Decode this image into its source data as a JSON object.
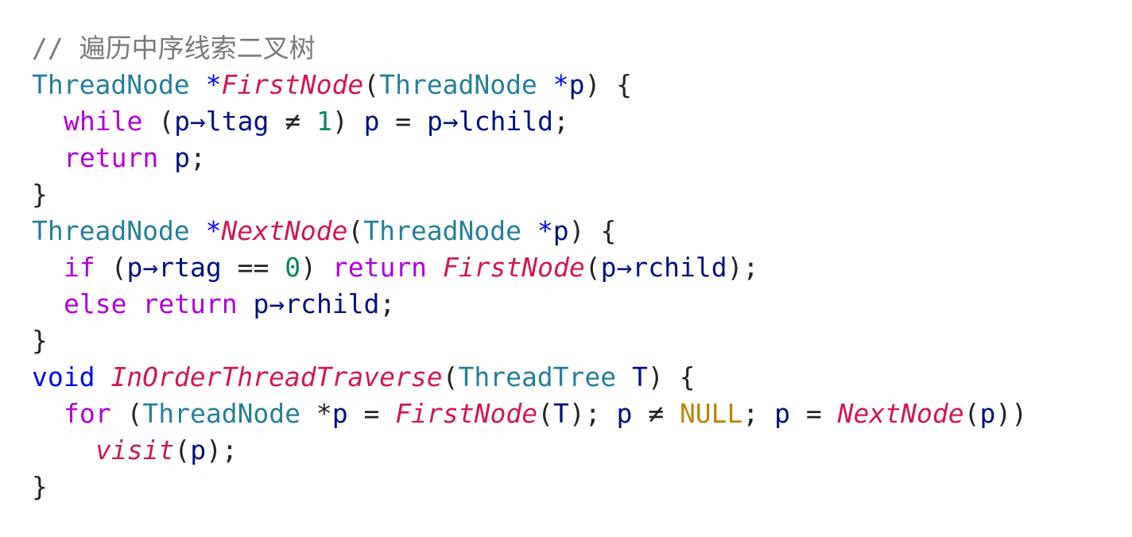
{
  "lines": [
    {
      "tokens": [
        "// 遍历中序线索二叉树"
      ]
    },
    {
      "tokens": [
        "ThreadNode",
        " ",
        "*",
        "FirstNode",
        "(",
        "ThreadNode",
        " ",
        "*",
        "p",
        ") {"
      ]
    },
    {
      "tokens": [
        "while",
        " (",
        "p",
        "→",
        "ltag",
        " ≠ ",
        "1",
        ") ",
        "p",
        " = ",
        "p",
        "→",
        "lchild",
        ";"
      ]
    },
    {
      "tokens": [
        "return",
        " ",
        "p",
        ";"
      ]
    },
    {
      "tokens": [
        "}"
      ]
    },
    {
      "tokens": [
        "ThreadNode",
        " ",
        "*",
        "NextNode",
        "(",
        "ThreadNode",
        " ",
        "*",
        "p",
        ") {"
      ]
    },
    {
      "tokens": [
        "if",
        " (",
        "p",
        "→",
        "rtag",
        " == ",
        "0",
        ") ",
        "return",
        " ",
        "FirstNode",
        "(",
        "p",
        "→",
        "rchild",
        ");"
      ]
    },
    {
      "tokens": [
        "else",
        " ",
        "return",
        " ",
        "p",
        "→",
        "rchild",
        ";"
      ]
    },
    {
      "tokens": [
        "}"
      ]
    },
    {
      "tokens": [
        "void",
        " ",
        "InOrderThreadTraverse",
        "(",
        "ThreadTree",
        " ",
        "T",
        ") {"
      ]
    },
    {
      "tokens": [
        "for",
        " (",
        "ThreadNode",
        " *",
        "p",
        " = ",
        "FirstNode",
        "(",
        "T",
        "); ",
        "p",
        " ≠ ",
        "NULL",
        "; ",
        "p",
        " = ",
        "NextNode",
        "(",
        "p",
        "))"
      ]
    },
    {
      "tokens": [
        "visit",
        "(",
        "p",
        ");"
      ]
    },
    {
      "tokens": [
        "}"
      ]
    }
  ],
  "colors": {
    "comment": "#7a7a7a",
    "type": "#267f99",
    "keyword": "#af00db",
    "type_keyword": "#0000ff",
    "function": "#d1194d",
    "number": "#098658",
    "constant": "#b8860b",
    "variable": "#001080",
    "punctuation": "#222222"
  }
}
